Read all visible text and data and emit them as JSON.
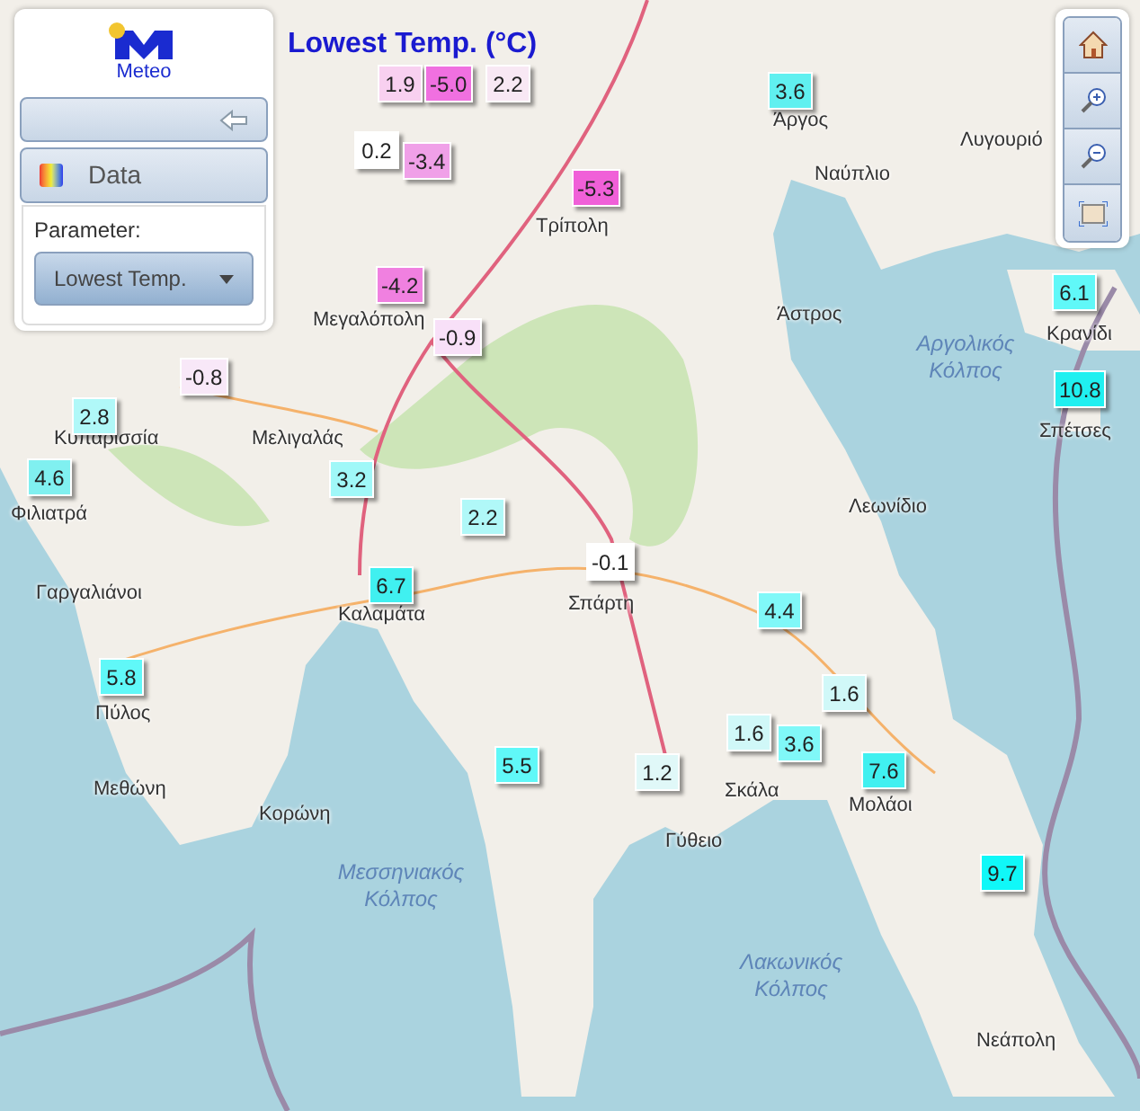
{
  "title": "Lowest Temp. (°C)",
  "panel": {
    "logo_text": "Meteo",
    "data_button": "Data",
    "parameter_label": "Parameter:",
    "parameter_value": "Lowest Temp."
  },
  "place_labels": [
    {
      "name": "Άργος",
      "kind": "town"
    },
    {
      "name": "Λυγουριό",
      "kind": "town"
    },
    {
      "name": "Ναύπλιο",
      "kind": "town"
    },
    {
      "name": "Τρίπολη",
      "kind": "town"
    },
    {
      "name": "Μεγαλόπολη",
      "kind": "town"
    },
    {
      "name": "Άστρος",
      "kind": "town"
    },
    {
      "name": "Αργολικός Κόλπος",
      "kind": "sea"
    },
    {
      "name": "Κρανίδι",
      "kind": "town"
    },
    {
      "name": "Κυπαρισσία",
      "kind": "town"
    },
    {
      "name": "Μελιγαλάς",
      "kind": "town"
    },
    {
      "name": "Σπέτσες",
      "kind": "town"
    },
    {
      "name": "Φιλιατρά",
      "kind": "town"
    },
    {
      "name": "Λεωνίδιο",
      "kind": "town"
    },
    {
      "name": "Γαργαλιάνοι",
      "kind": "town"
    },
    {
      "name": "Καλαμάτα",
      "kind": "town"
    },
    {
      "name": "Σπάρτη",
      "kind": "town"
    },
    {
      "name": "Πύλος",
      "kind": "town"
    },
    {
      "name": "Μεθώνη",
      "kind": "town"
    },
    {
      "name": "Κορώνη",
      "kind": "town"
    },
    {
      "name": "Σκάλα",
      "kind": "town"
    },
    {
      "name": "Μολάοι",
      "kind": "town"
    },
    {
      "name": "Γύθειο",
      "kind": "town"
    },
    {
      "name": "Μεσσηνιακός Κόλπος",
      "kind": "sea"
    },
    {
      "name": "Λακωνικός Κόλπος",
      "kind": "sea"
    },
    {
      "name": "Νεάπολη",
      "kind": "town"
    }
  ],
  "markers": [
    {
      "value": "1.9",
      "color": "#f8d0f0"
    },
    {
      "value": "-5.0",
      "color": "#f070e0"
    },
    {
      "value": "2.2",
      "color": "#f8e8f4"
    },
    {
      "value": "3.6",
      "color": "#60f0f0"
    },
    {
      "value": "0.2",
      "color": "#ffffff"
    },
    {
      "value": "-3.4",
      "color": "#f0a0e8"
    },
    {
      "value": "-5.3",
      "color": "#f060d8"
    },
    {
      "value": "-4.2",
      "color": "#f080e0"
    },
    {
      "value": "6.1",
      "color": "#60f8f8"
    },
    {
      "value": "-0.9",
      "color": "#f8e0f8"
    },
    {
      "value": "-0.8",
      "color": "#f8e8f8"
    },
    {
      "value": "2.8",
      "color": "#b0f8f8"
    },
    {
      "value": "10.8",
      "color": "#20f0f0"
    },
    {
      "value": "4.6",
      "color": "#80f0f0"
    },
    {
      "value": "3.2",
      "color": "#a0f8f8"
    },
    {
      "value": "2.2",
      "color": "#b0f8f8"
    },
    {
      "value": "6.7",
      "color": "#40f0f0"
    },
    {
      "value": "-0.1",
      "color": "#ffffff"
    },
    {
      "value": "4.4",
      "color": "#80f8f8"
    },
    {
      "value": "5.8",
      "color": "#60f8f8"
    },
    {
      "value": "1.6",
      "color": "#d0f8f8"
    },
    {
      "value": "5.5",
      "color": "#60f8f8"
    },
    {
      "value": "1.6",
      "color": "#d0f8f8"
    },
    {
      "value": "1.2",
      "color": "#e0f8f8"
    },
    {
      "value": "3.6",
      "color": "#80f8f8"
    },
    {
      "value": "7.6",
      "color": "#40f0f0"
    },
    {
      "value": "9.7",
      "color": "#10f8f8"
    }
  ]
}
